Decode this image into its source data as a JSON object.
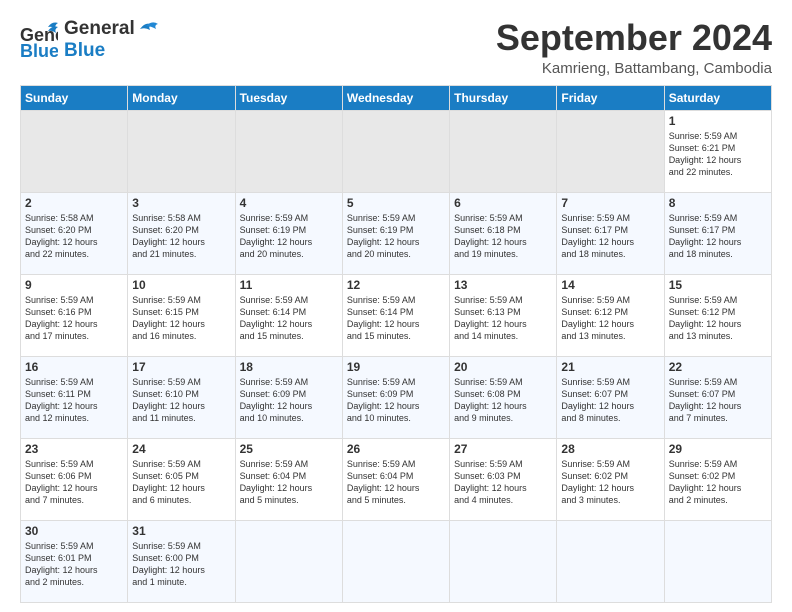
{
  "header": {
    "logo_line1": "General",
    "logo_line2": "Blue",
    "main_title": "September 2024",
    "subtitle": "Kamrieng, Battambang, Cambodia"
  },
  "calendar": {
    "days_of_week": [
      "Sunday",
      "Monday",
      "Tuesday",
      "Wednesday",
      "Thursday",
      "Friday",
      "Saturday"
    ],
    "weeks": [
      [
        {
          "num": "",
          "empty": true
        },
        {
          "num": "",
          "empty": true
        },
        {
          "num": "",
          "empty": true
        },
        {
          "num": "",
          "empty": true
        },
        {
          "num": "",
          "empty": true
        },
        {
          "num": "",
          "empty": true
        },
        {
          "num": "1",
          "info": "Sunrise: 5:59 AM\nSunset: 6:21 PM\nDaylight: 12 hours\nand 22 minutes."
        }
      ],
      [
        {
          "num": "2",
          "info": "Sunrise: 5:58 AM\nSunset: 6:20 PM\nDaylight: 12 hours\nand 22 minutes."
        },
        {
          "num": "3",
          "info": "Sunrise: 5:58 AM\nSunset: 6:20 PM\nDaylight: 12 hours\nand 21 minutes."
        },
        {
          "num": "4",
          "info": "Sunrise: 5:59 AM\nSunset: 6:19 PM\nDaylight: 12 hours\nand 20 minutes."
        },
        {
          "num": "5",
          "info": "Sunrise: 5:59 AM\nSunset: 6:19 PM\nDaylight: 12 hours\nand 20 minutes."
        },
        {
          "num": "6",
          "info": "Sunrise: 5:59 AM\nSunset: 6:18 PM\nDaylight: 12 hours\nand 19 minutes."
        },
        {
          "num": "7",
          "info": "Sunrise: 5:59 AM\nSunset: 6:17 PM\nDaylight: 12 hours\nand 18 minutes."
        },
        {
          "num": "8",
          "info": "Sunrise: 5:59 AM\nSunset: 6:17 PM\nDaylight: 12 hours\nand 18 minutes."
        }
      ],
      [
        {
          "num": "9",
          "info": "Sunrise: 5:59 AM\nSunset: 6:16 PM\nDaylight: 12 hours\nand 17 minutes."
        },
        {
          "num": "10",
          "info": "Sunrise: 5:59 AM\nSunset: 6:15 PM\nDaylight: 12 hours\nand 16 minutes."
        },
        {
          "num": "11",
          "info": "Sunrise: 5:59 AM\nSunset: 6:14 PM\nDaylight: 12 hours\nand 15 minutes."
        },
        {
          "num": "12",
          "info": "Sunrise: 5:59 AM\nSunset: 6:14 PM\nDaylight: 12 hours\nand 15 minutes."
        },
        {
          "num": "13",
          "info": "Sunrise: 5:59 AM\nSunset: 6:13 PM\nDaylight: 12 hours\nand 14 minutes."
        },
        {
          "num": "14",
          "info": "Sunrise: 5:59 AM\nSunset: 6:12 PM\nDaylight: 12 hours\nand 13 minutes."
        },
        {
          "num": "15",
          "info": "Sunrise: 5:59 AM\nSunset: 6:12 PM\nDaylight: 12 hours\nand 13 minutes."
        }
      ],
      [
        {
          "num": "16",
          "info": "Sunrise: 5:59 AM\nSunset: 6:11 PM\nDaylight: 12 hours\nand 12 minutes."
        },
        {
          "num": "17",
          "info": "Sunrise: 5:59 AM\nSunset: 6:10 PM\nDaylight: 12 hours\nand 11 minutes."
        },
        {
          "num": "18",
          "info": "Sunrise: 5:59 AM\nSunset: 6:09 PM\nDaylight: 12 hours\nand 10 minutes."
        },
        {
          "num": "19",
          "info": "Sunrise: 5:59 AM\nSunset: 6:09 PM\nDaylight: 12 hours\nand 10 minutes."
        },
        {
          "num": "20",
          "info": "Sunrise: 5:59 AM\nSunset: 6:08 PM\nDaylight: 12 hours\nand 9 minutes."
        },
        {
          "num": "21",
          "info": "Sunrise: 5:59 AM\nSunset: 6:07 PM\nDaylight: 12 hours\nand 8 minutes."
        },
        {
          "num": "22",
          "info": "Sunrise: 5:59 AM\nSunset: 6:07 PM\nDaylight: 12 hours\nand 7 minutes."
        }
      ],
      [
        {
          "num": "23",
          "info": "Sunrise: 5:59 AM\nSunset: 6:06 PM\nDaylight: 12 hours\nand 7 minutes."
        },
        {
          "num": "24",
          "info": "Sunrise: 5:59 AM\nSunset: 6:05 PM\nDaylight: 12 hours\nand 6 minutes."
        },
        {
          "num": "25",
          "info": "Sunrise: 5:59 AM\nSunset: 6:04 PM\nDaylight: 12 hours\nand 5 minutes."
        },
        {
          "num": "26",
          "info": "Sunrise: 5:59 AM\nSunset: 6:04 PM\nDaylight: 12 hours\nand 5 minutes."
        },
        {
          "num": "27",
          "info": "Sunrise: 5:59 AM\nSunset: 6:03 PM\nDaylight: 12 hours\nand 4 minutes."
        },
        {
          "num": "28",
          "info": "Sunrise: 5:59 AM\nSunset: 6:02 PM\nDaylight: 12 hours\nand 3 minutes."
        },
        {
          "num": "29",
          "info": "Sunrise: 5:59 AM\nSunset: 6:02 PM\nDaylight: 12 hours\nand 2 minutes."
        }
      ],
      [
        {
          "num": "30",
          "info": "Sunrise: 5:59 AM\nSunset: 6:01 PM\nDaylight: 12 hours\nand 2 minutes."
        },
        {
          "num": "31",
          "info": "Sunrise: 5:59 AM\nSunset: 6:00 PM\nDaylight: 12 hours\nand 1 minute."
        },
        {
          "num": "",
          "empty": true
        },
        {
          "num": "",
          "empty": true
        },
        {
          "num": "",
          "empty": true
        },
        {
          "num": "",
          "empty": true
        },
        {
          "num": "",
          "empty": true
        }
      ]
    ]
  }
}
